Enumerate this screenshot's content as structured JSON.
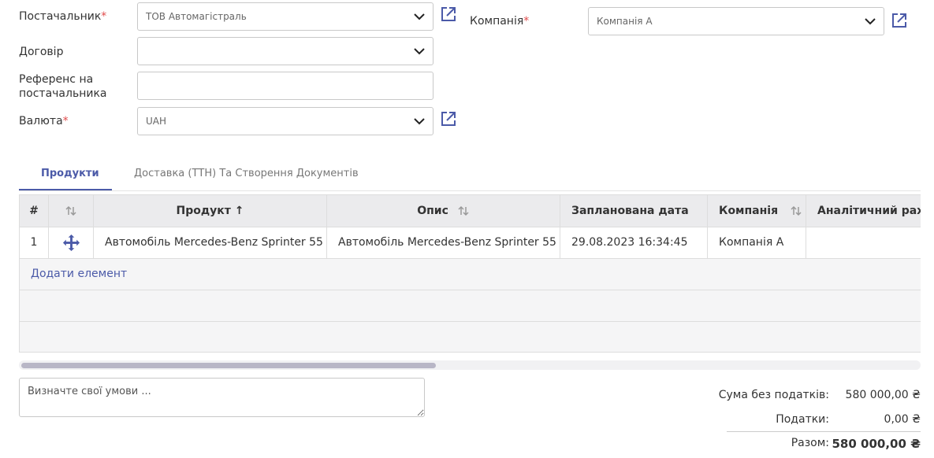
{
  "form": {
    "vendor": {
      "label": "Постачальник",
      "value": "ТОВ Автомагістраль"
    },
    "company": {
      "label": "Компанія",
      "value": "Компанія А"
    },
    "contract": {
      "label": "Договір",
      "value": ""
    },
    "vendor_ref": {
      "label": "Референс на постачальника",
      "value": ""
    },
    "currency": {
      "label": "Валюта",
      "value": "UAH"
    },
    "required_mark": "*"
  },
  "tabs": [
    {
      "label": "Продукти",
      "active": true
    },
    {
      "label": "Доставка (ТТН) Та Створення Документів",
      "active": false
    }
  ],
  "table": {
    "headers": {
      "num": "#",
      "product": "Продукт",
      "product_sort": "↑",
      "description": "Опис",
      "planned_date": "Запланована дата",
      "company": "Компанія",
      "analytic": "Аналітичний рахунок"
    },
    "rows": [
      {
        "num": "1",
        "product": "Автомобіль Mercedes-Benz Sprinter 55",
        "description": "Автомобіль Mercedes-Benz Sprinter 55",
        "planned_date": "29.08.2023 16:34:45",
        "company": "Компанія А",
        "analytic": ""
      }
    ],
    "add_item": "Додати елемент"
  },
  "terms": {
    "placeholder": "Визначте свої умови ..."
  },
  "totals": {
    "untaxed_label": "Сума без податків:",
    "untaxed_value": "580 000,00 ₴",
    "taxes_label": "Податки:",
    "taxes_value": "0,00 ₴",
    "total_label": "Разом:",
    "total_value": "580 000,00 ₴"
  },
  "colors": {
    "accent": "#4b5aa8",
    "required": "#e04b4b",
    "link_icon": "#4b5aa8"
  },
  "icons": [
    "chevron-down-icon",
    "external-link-icon",
    "drag-handle-icon",
    "sort-icon"
  ]
}
